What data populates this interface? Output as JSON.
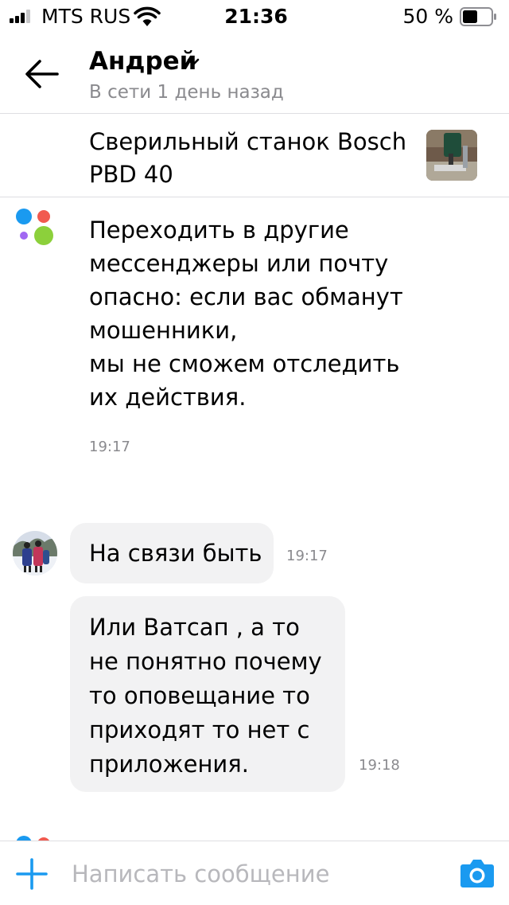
{
  "status_bar": {
    "carrier": "MTS RUS",
    "time": "21:36",
    "battery_percent": "50 %",
    "battery_level": 0.5,
    "signal_bars": 3,
    "icons": [
      "signal-icon",
      "wifi-icon",
      "battery-icon"
    ]
  },
  "header": {
    "back_icon": "arrow-left-icon",
    "contact_name": "Андрей",
    "name_icon": "chevron-down-icon",
    "contact_status": "В сети 1 день назад"
  },
  "product": {
    "title": "Сверильный станок Bosch PBD 40",
    "thumbnail": "product-photo"
  },
  "system_message": {
    "logo": "avito-logo",
    "text": "Переходить в другие мессенджеры или почту опасно: если вас обманут мошенники,\nмы не сможем отследить их действия.",
    "time": "19:17"
  },
  "messages": [
    {
      "text": "На связи быть",
      "time": "19:17"
    },
    {
      "text": "Или Ватсап , а то не понятно почему то оповещание то приходят то нет с приложения.",
      "time": "19:18"
    }
  ],
  "composer": {
    "add_icon": "plus-icon",
    "placeholder": "Написать сообщение",
    "camera_icon": "camera-icon"
  },
  "colors": {
    "accent": "#1a9af0",
    "bubble": "#f2f2f3",
    "secondary_text": "#8a8a8e",
    "logo_blue": "#1a9af0",
    "logo_red": "#f15a4f",
    "logo_purple": "#a168f2",
    "logo_green": "#8cd03b"
  }
}
